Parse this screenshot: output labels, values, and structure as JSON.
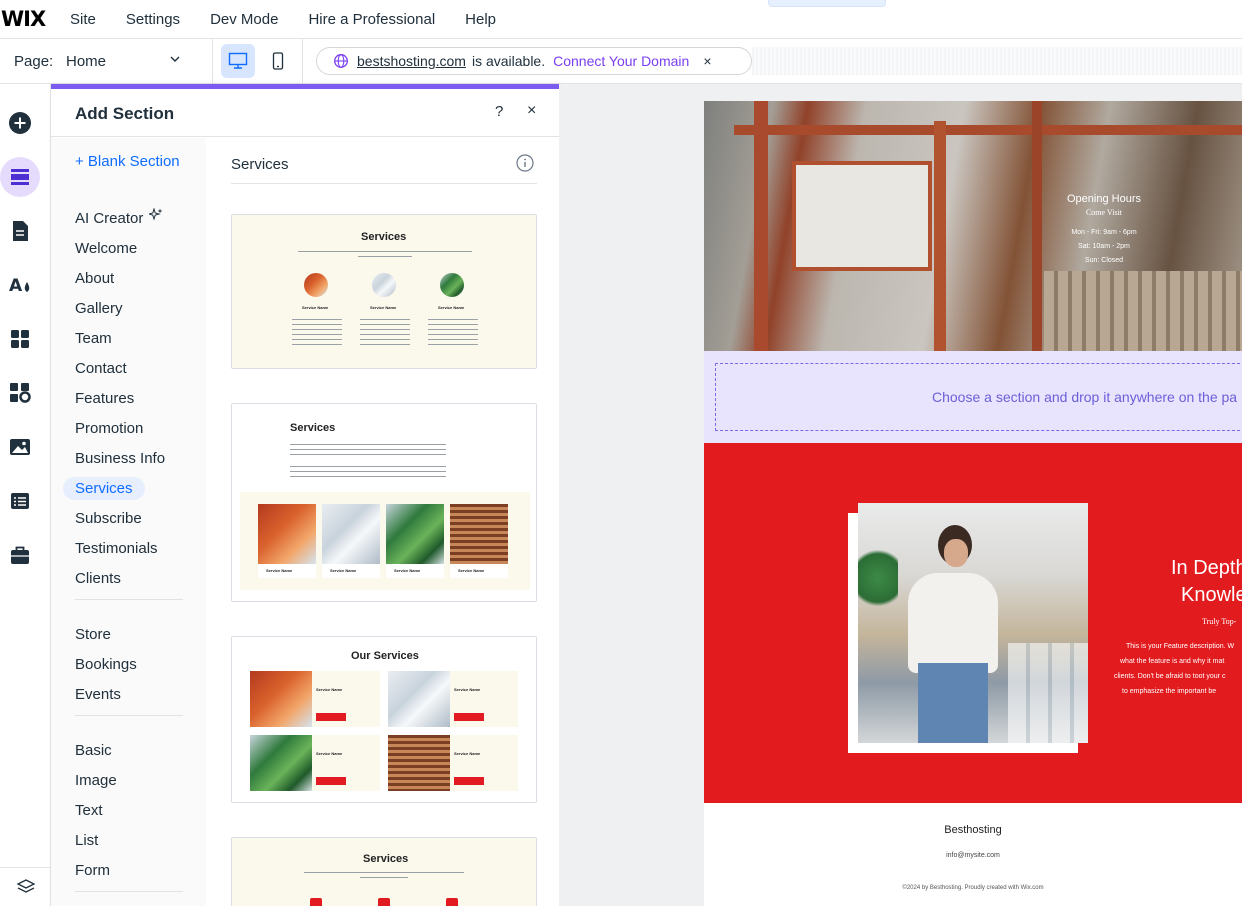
{
  "topbar": {
    "logo": "WIX",
    "menu": [
      "Site",
      "Settings",
      "Dev Mode",
      "Hire a Professional",
      "Help"
    ]
  },
  "pagebar": {
    "page_label": "Page:",
    "page_name": "Home",
    "domain_name": "bestshosting.com",
    "domain_text": "is available.",
    "domain_link": "Connect Your Domain",
    "close_glyph": "×"
  },
  "panel": {
    "title": "Add Section",
    "help_glyph": "?",
    "close_glyph": "×",
    "blank_section": "+ Blank Section",
    "categories_1": [
      "AI Creator",
      "Welcome",
      "About",
      "Gallery",
      "Team",
      "Contact",
      "Features",
      "Promotion",
      "Business Info",
      "Services",
      "Subscribe",
      "Testimonials",
      "Clients"
    ],
    "categories_2": [
      "Store",
      "Bookings",
      "Events"
    ],
    "categories_3": [
      "Basic",
      "Image",
      "Text",
      "List",
      "Form"
    ],
    "selected_category": "Services",
    "section_heading": "Services",
    "thumbs": [
      {
        "title": "Services",
        "item_label": "Service Name"
      },
      {
        "title": "Services",
        "item_label": "Service Name"
      },
      {
        "title": "Our Services",
        "item_label": "Service Name"
      },
      {
        "title": "Services"
      }
    ]
  },
  "site": {
    "hours": {
      "title": "Opening Hours",
      "subtitle": "Come Visit",
      "lines": [
        "Mon - Fri: 9am - 6pm",
        "Sat: 10am - 2pm",
        "Sun: Closed"
      ]
    },
    "drop_text": "Choose a section and drop it anywhere on the pa",
    "feature": {
      "title_line1": "In Depth",
      "title_line2": "Knowle",
      "subtitle": "Truly Top-",
      "desc": [
        "This is your Feature description. W",
        "what the feature is and why it mat",
        "clients. Don't be afraid to toot your c",
        "to emphasize the important be"
      ]
    },
    "footer": {
      "name": "Besthosting",
      "email": "info@mysite.com",
      "copyright": "©2024 by Besthosting. Proudly created with Wix.com"
    }
  },
  "colors": {
    "accent": "#116dff",
    "purple": "#7a3ff0",
    "feature_red": "#e21b1f"
  }
}
